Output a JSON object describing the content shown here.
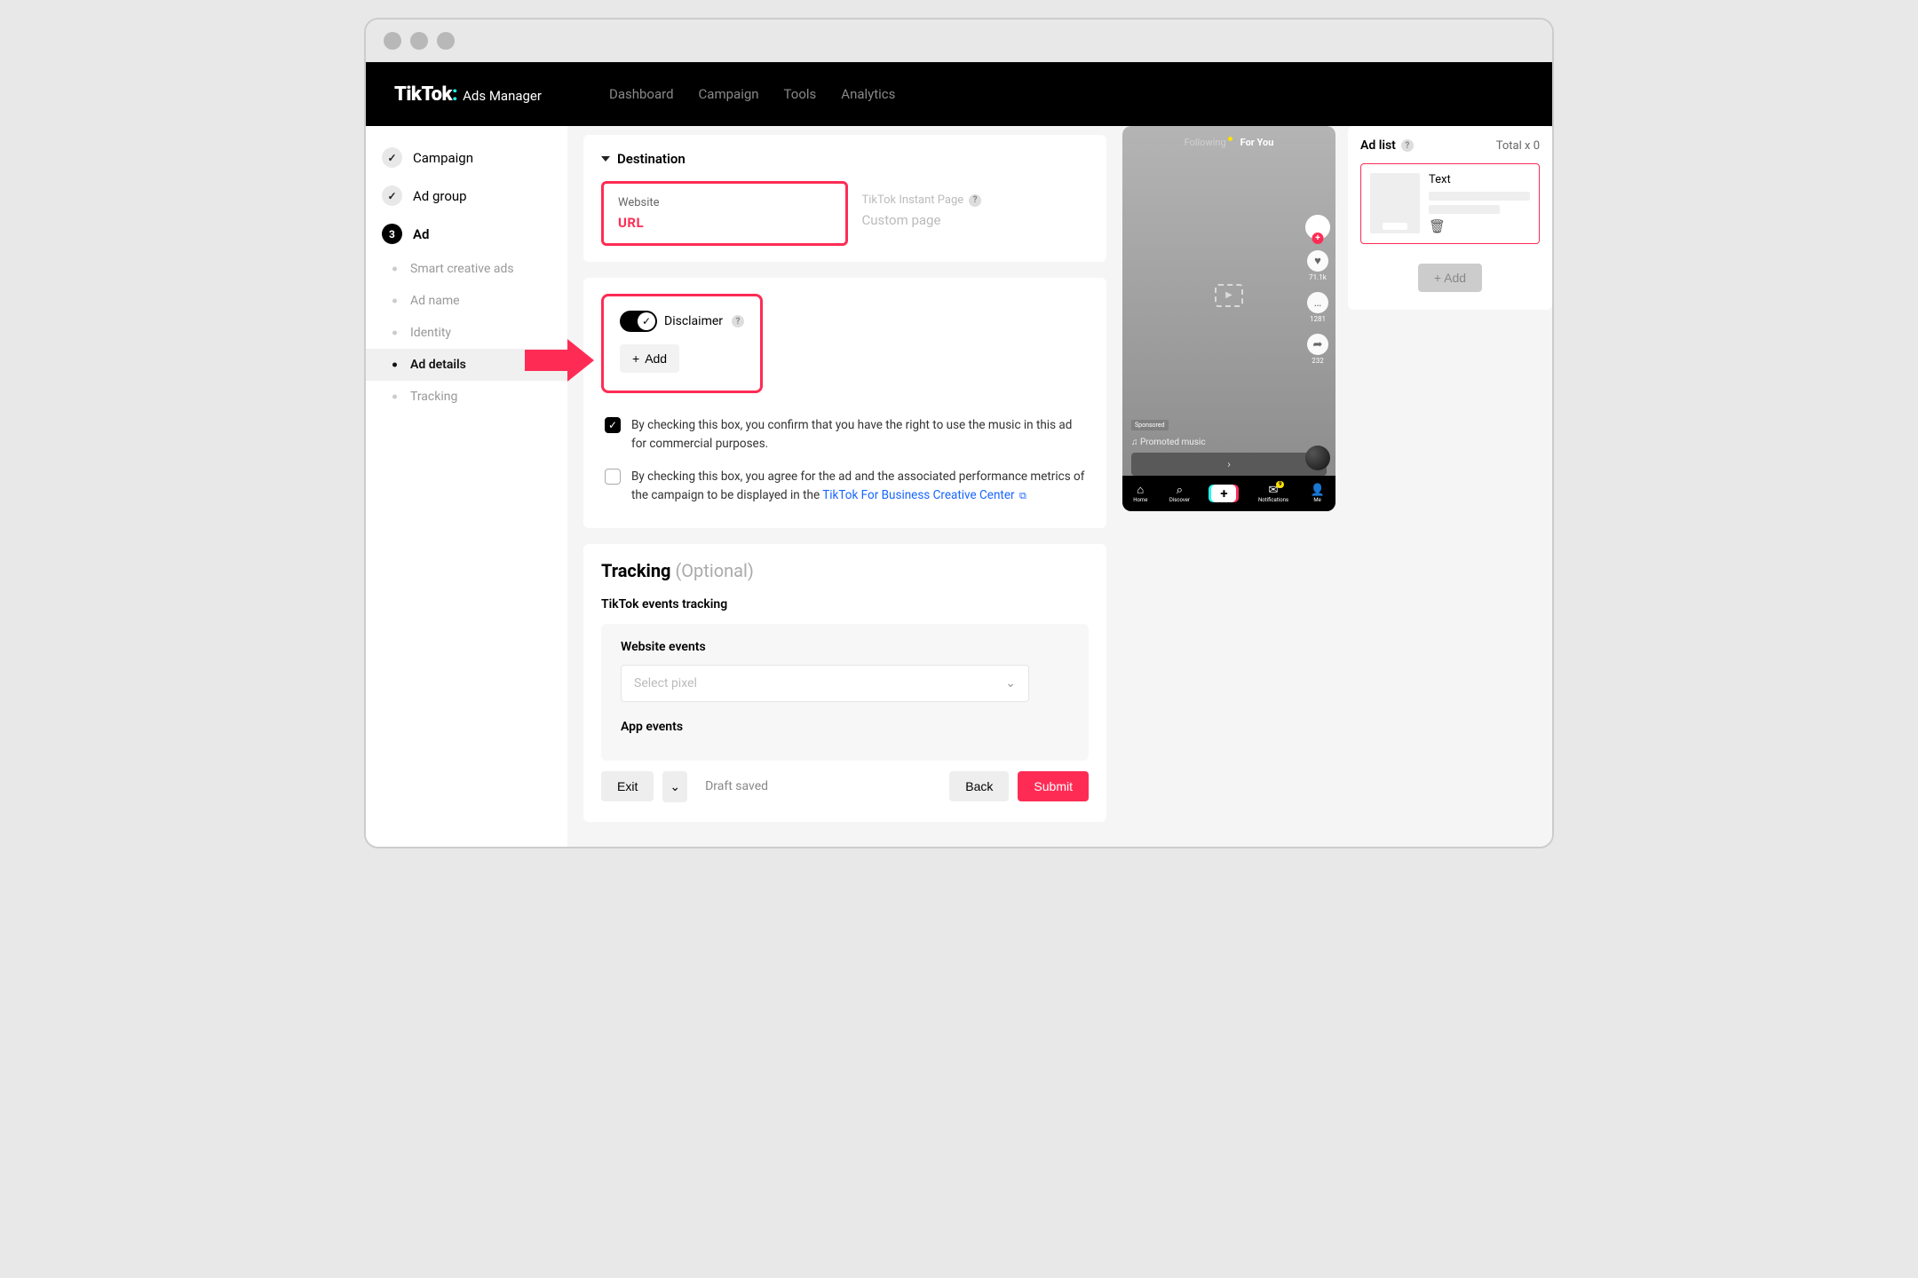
{
  "brand": {
    "logo": "TikTok",
    "sub": "Ads Manager"
  },
  "nav": {
    "dashboard": "Dashboard",
    "campaign": "Campaign",
    "tools": "Tools",
    "analytics": "Analytics"
  },
  "sidebar": {
    "campaign": "Campaign",
    "adgroup": "Ad group",
    "ad": "Ad",
    "ad_num": "3",
    "subs": {
      "smart": "Smart creative ads",
      "adname": "Ad name",
      "identity": "Identity",
      "details": "Ad details",
      "tracking": "Tracking"
    }
  },
  "destination": {
    "title": "Destination",
    "website": {
      "label": "Website",
      "value": "URL"
    },
    "instant": {
      "label": "TikTok Instant Page",
      "value": "Custom page"
    }
  },
  "disclaimer": {
    "label": "Disclaimer",
    "add": "Add"
  },
  "checks": {
    "music": "By checking this box, you confirm that you have the right to use the music in this ad for commercial purposes.",
    "cc_pre": "By checking this box, you agree for the ad and the associated performance metrics of the campaign to be displayed in the ",
    "cc_link": "TikTok For Business Creative Center"
  },
  "tracking": {
    "title": "Tracking",
    "optional": "(Optional)",
    "events_title": "TikTok events tracking",
    "website_events": "Website events",
    "select_pixel": "Select pixel",
    "app_events": "App events"
  },
  "footer": {
    "exit": "Exit",
    "draft": "Draft saved",
    "back": "Back",
    "submit": "Submit"
  },
  "preview": {
    "following": "Following",
    "foryou": "For You",
    "likes": "71.1k",
    "comments": "1281",
    "shares": "232",
    "sponsored": "Sponsored",
    "promoted": "♫ Promoted music",
    "cta_arrow": "›",
    "nav": {
      "home": "Home",
      "discover": "Discover",
      "inbox": "Notifications",
      "inbox_count": "9",
      "me": "Me"
    }
  },
  "adlist": {
    "title": "Ad list",
    "total": "Total x 0",
    "item_text": "Text",
    "add": "+ Add"
  }
}
